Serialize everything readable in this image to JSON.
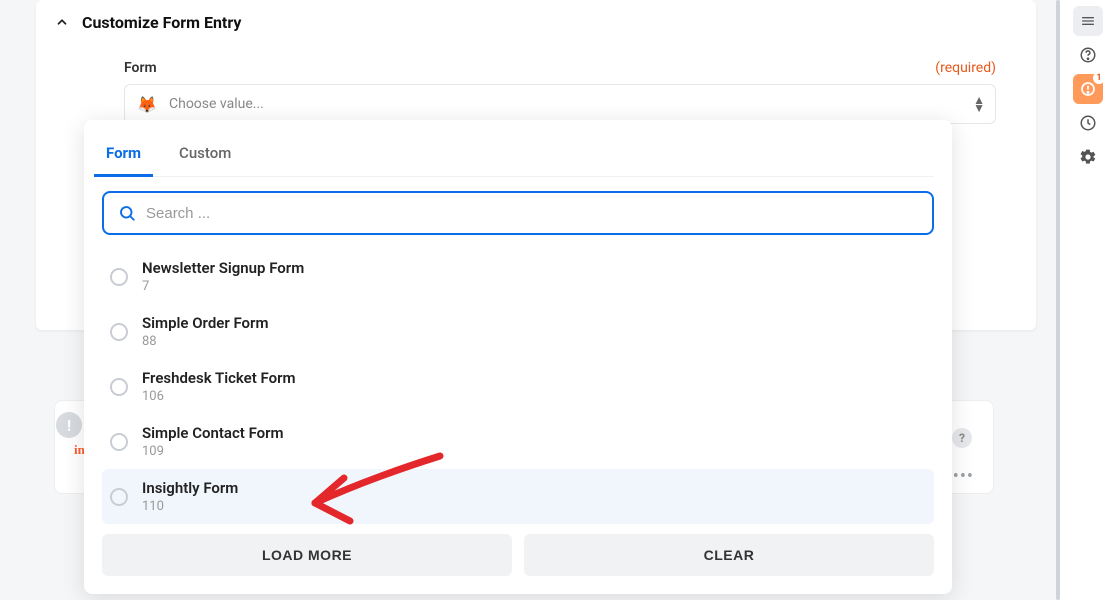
{
  "header": {
    "title": "Customize Form Entry"
  },
  "form_field": {
    "label": "Form",
    "required_label": "(required)",
    "placeholder": "Choose value...",
    "icon": "🦊"
  },
  "dropdown": {
    "tabs": [
      {
        "label": "Form",
        "active": true
      },
      {
        "label": "Custom",
        "active": false
      }
    ],
    "search_placeholder": "Search ...",
    "options": [
      {
        "title": "Newsletter Signup Form",
        "id": "7",
        "highlighted": false
      },
      {
        "title": "Simple Order Form",
        "id": "88",
        "highlighted": false
      },
      {
        "title": "Freshdesk Ticket Form",
        "id": "106",
        "highlighted": false
      },
      {
        "title": "Simple Contact Form",
        "id": "109",
        "highlighted": false
      },
      {
        "title": "Insightly Form",
        "id": "110",
        "highlighted": true
      }
    ],
    "load_more_label": "LOAD MORE",
    "clear_label": "CLEAR"
  },
  "right_rail": {
    "alert_badge": "1"
  },
  "background": {
    "logo_text": "insig",
    "badge_char": "!",
    "help_char": "?",
    "dots": "•••"
  }
}
